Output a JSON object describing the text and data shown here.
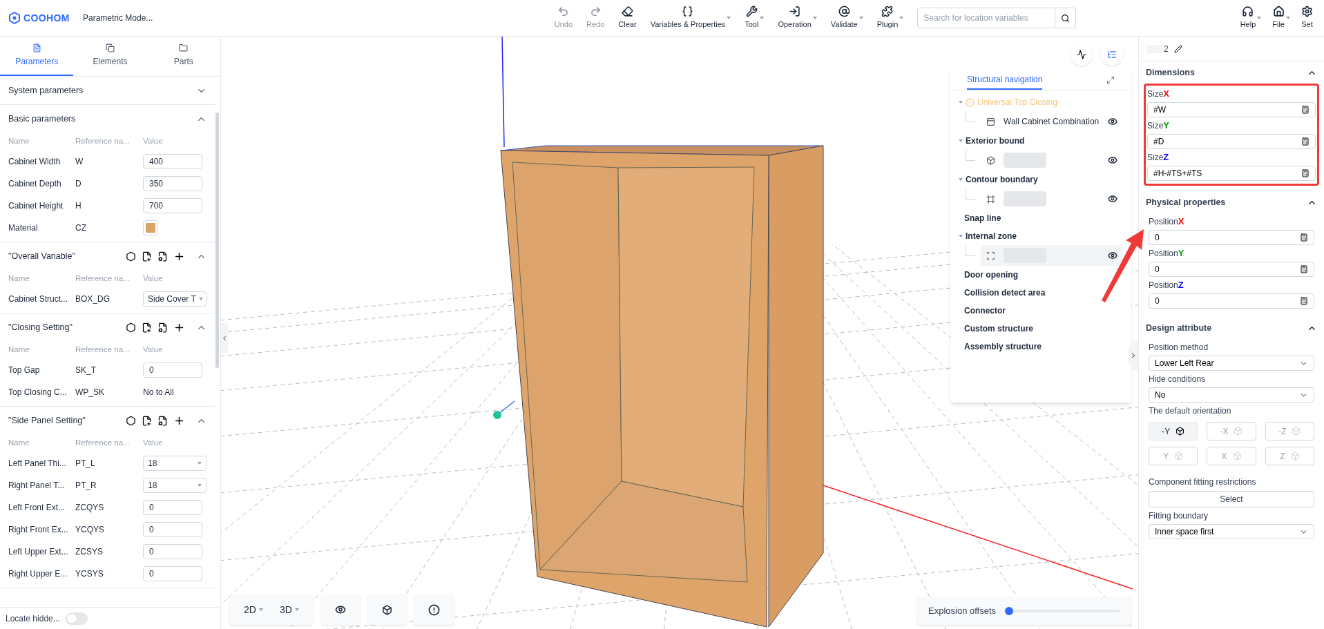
{
  "app": {
    "logo": "COOHOM",
    "title": "Parametric Mode..."
  },
  "toolbar": {
    "tools": [
      {
        "kind": "undo",
        "label": "Undo",
        "disabled": true,
        "dropdown": false
      },
      {
        "kind": "redo",
        "label": "Redo",
        "disabled": true,
        "dropdown": false
      },
      {
        "kind": "clear",
        "label": "Clear",
        "disabled": false,
        "dropdown": false
      },
      {
        "kind": "variables",
        "label": "Variables & Properties",
        "disabled": false,
        "dropdown": true
      },
      {
        "kind": "tool",
        "label": "Tool",
        "disabled": false,
        "dropdown": true
      },
      {
        "kind": "operation",
        "label": "Operation",
        "disabled": false,
        "dropdown": true
      },
      {
        "kind": "validate",
        "label": "Validate",
        "disabled": false,
        "dropdown": true
      },
      {
        "kind": "plugin",
        "label": "Plugin",
        "disabled": false,
        "dropdown": true
      }
    ],
    "search": {
      "placeholder": "Search for location variables"
    },
    "right": [
      {
        "kind": "help",
        "label": "Help",
        "dropdown": true
      },
      {
        "kind": "file",
        "label": "File",
        "dropdown": true
      },
      {
        "kind": "set",
        "label": "Set",
        "dropdown": false
      }
    ]
  },
  "left_panel": {
    "tabs": [
      {
        "kind": "parameters",
        "label": "Parameters",
        "selected": true
      },
      {
        "kind": "elements",
        "label": "Elements",
        "selected": false
      },
      {
        "kind": "parts",
        "label": "Parts",
        "selected": false
      }
    ],
    "sections": [
      {
        "title": "System parameters",
        "expanded": false,
        "actions": false
      },
      {
        "title": "Basic parameters",
        "expanded": true,
        "actions": false,
        "columns": [
          "Name",
          "Reference na...",
          "Value"
        ],
        "rows": [
          {
            "name": "Cabinet Width",
            "ref": "W",
            "kind": "input",
            "value": "400"
          },
          {
            "name": "Cabinet Depth",
            "ref": "D",
            "kind": "input",
            "value": "350"
          },
          {
            "name": "Cabinet Height",
            "ref": "H",
            "kind": "input",
            "value": "700"
          },
          {
            "name": "Material",
            "ref": "CZ",
            "kind": "swatch",
            "color": "#d9a567"
          }
        ]
      },
      {
        "title": "\"Overall Variable\"",
        "expanded": true,
        "actions": true,
        "columns": [
          "Name",
          "Reference na...",
          "Value"
        ],
        "rows": [
          {
            "name": "Cabinet Struct...",
            "ref": "BOX_DG",
            "kind": "select",
            "value": "Side Cover T"
          }
        ]
      },
      {
        "title": "\"Closing Setting\"",
        "expanded": true,
        "actions": true,
        "columns": [
          "Name",
          "Reference na...",
          "Value"
        ],
        "rows": [
          {
            "name": "Top Gap",
            "ref": "SK_T",
            "kind": "input",
            "value": "0"
          },
          {
            "name": "Top Closing C...",
            "ref": "WP_SK",
            "kind": "text",
            "value": "No to All"
          }
        ]
      },
      {
        "title": "\"Side Panel Setting\"",
        "expanded": true,
        "actions": true,
        "columns": [
          "Name",
          "Reference na...",
          "Value"
        ],
        "rows": [
          {
            "name": "Left Panel Thi...",
            "ref": "PT_L",
            "kind": "select",
            "value": "18"
          },
          {
            "name": "Right Panel T...",
            "ref": "PT_R",
            "kind": "select",
            "value": "18"
          },
          {
            "name": "Left Front Ext...",
            "ref": "ZCQYS",
            "kind": "input",
            "value": "0"
          },
          {
            "name": "Right Front Ex...",
            "ref": "YCQYS",
            "kind": "input",
            "value": "0"
          },
          {
            "name": "Left Upper Ext...",
            "ref": "ZCSYS",
            "kind": "input",
            "value": "0"
          },
          {
            "name": "Right Upper E...",
            "ref": "YCSYS",
            "kind": "input",
            "value": "0"
          }
        ]
      }
    ],
    "locate": {
      "label": "Locate hidde...",
      "on": false
    }
  },
  "viewport": {
    "view_buttons": [
      {
        "kind": "menu",
        "label": "2D"
      },
      {
        "kind": "menu",
        "label": "3D"
      },
      {
        "kind": "eye"
      },
      {
        "kind": "cube"
      },
      {
        "kind": "alert"
      }
    ],
    "explosion": {
      "label": "Explosion offsets",
      "level": 0.02
    }
  },
  "structure_nav": {
    "title": "Structural navigation",
    "items": [
      {
        "label": "Universal Top Closing",
        "kind": "warning",
        "children": [
          {
            "kind": "panel",
            "label": "Wall Cabinet Combination",
            "selected": false
          }
        ]
      },
      {
        "label": "Exterior bound",
        "kind": "group",
        "children": [
          {
            "kind": "cube",
            "selected": false
          }
        ]
      },
      {
        "label": "Contour boundary",
        "kind": "group",
        "children": [
          {
            "kind": "contour",
            "selected": false
          }
        ]
      },
      {
        "label": "Snap line",
        "kind": "group"
      },
      {
        "label": "Internal zone",
        "kind": "group",
        "children": [
          {
            "kind": "zone",
            "selected": true
          }
        ]
      },
      {
        "label": "Door opening",
        "kind": "group"
      },
      {
        "label": "Collision detect area",
        "kind": "group"
      },
      {
        "label": "Connector",
        "kind": "group"
      },
      {
        "label": "Custom structure",
        "kind": "group"
      },
      {
        "label": "Assembly structure",
        "kind": "group"
      }
    ]
  },
  "right_panel": {
    "name": "2",
    "sections": [
      {
        "title": "Dimensions",
        "expanded": true,
        "highlighted": true,
        "fields": [
          {
            "kind": "formula",
            "label": "Size",
            "axis": "X",
            "color": "#ff0000",
            "value": "#W"
          },
          {
            "kind": "formula",
            "label": "Size",
            "axis": "Y",
            "color": "#00a000",
            "value": "#D"
          },
          {
            "kind": "formula",
            "label": "Size",
            "axis": "Z",
            "color": "#0000ff",
            "value": "#H-#TS+#TS"
          }
        ]
      },
      {
        "title": "Physical properties",
        "expanded": true,
        "highlighted": false,
        "fields": [
          {
            "kind": "formula",
            "label": "Position",
            "axis": "X",
            "color": "#ff0000",
            "value": "0"
          },
          {
            "kind": "formula",
            "label": "Position",
            "axis": "Y",
            "color": "#00a000",
            "value": "0"
          },
          {
            "kind": "formula",
            "label": "Position",
            "axis": "Z",
            "color": "#0000ff",
            "value": "0"
          }
        ]
      },
      {
        "title": "Design attribute",
        "expanded": true,
        "highlighted": false,
        "fields": [
          {
            "kind": "select",
            "label": "Position method",
            "value": "Lower Left Rear"
          },
          {
            "kind": "select",
            "label": "Hide conditions",
            "value": "No"
          },
          {
            "kind": "orientation",
            "label": "The default orientation",
            "options": [
              {
                "label": "-Y",
                "selected": true
              },
              {
                "label": "-X",
                "selected": false
              },
              {
                "label": "-Z",
                "selected": false
              },
              {
                "label": "Y",
                "selected": false
              },
              {
                "label": "X",
                "selected": false
              },
              {
                "label": "Z",
                "selected": false
              }
            ]
          },
          {
            "kind": "button",
            "label": "Component fitting restrictions",
            "value": "Select"
          },
          {
            "kind": "select",
            "label": "Fitting boundary",
            "value": "Inner space first"
          }
        ]
      }
    ]
  }
}
